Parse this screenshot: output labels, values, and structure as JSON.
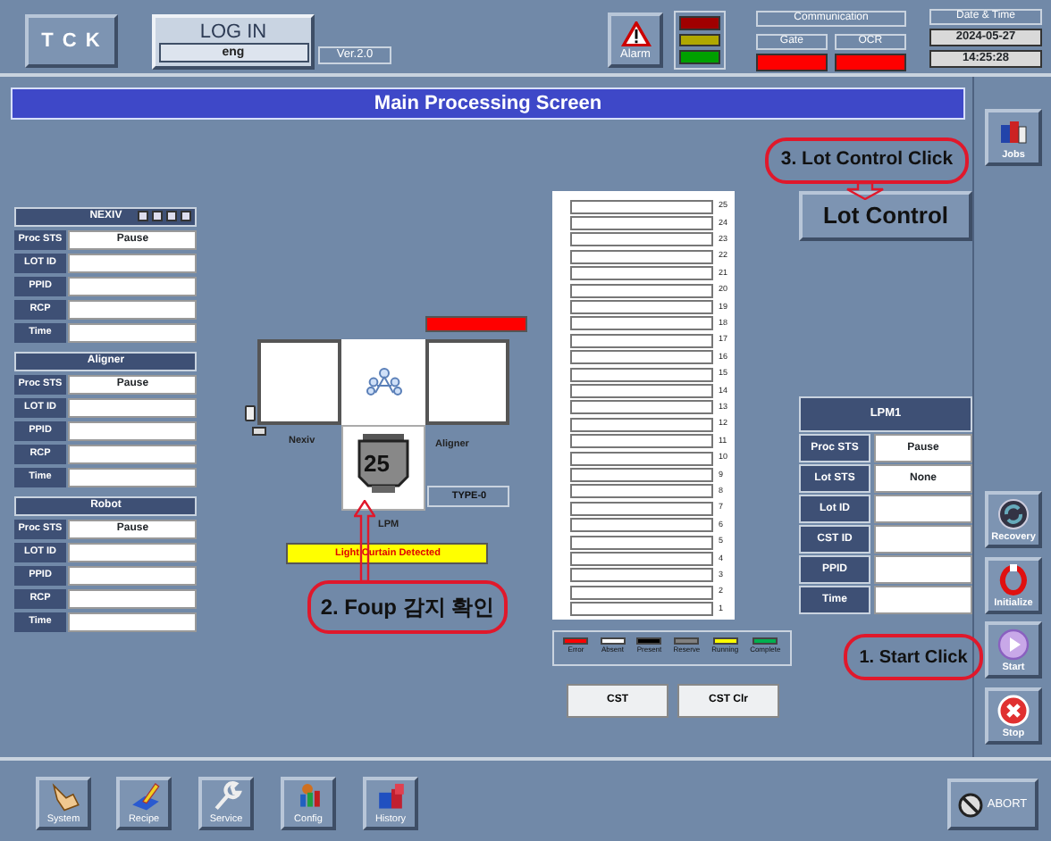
{
  "header": {
    "logo": "T C K",
    "login": {
      "label": "LOG IN",
      "user": "eng"
    },
    "version": "Ver.2.0",
    "alarm": "Alarm",
    "tower": [
      {
        "color": "#a00000"
      },
      {
        "color": "#b0a800"
      },
      {
        "color": "#00a000"
      }
    ],
    "communication": {
      "title": "Communication",
      "channels": [
        {
          "label": "Gate",
          "color": "#ff0000"
        },
        {
          "label": "OCR",
          "color": "#ff0000"
        }
      ]
    },
    "datetime": {
      "title": "Date & Time",
      "date": "2024-05-27",
      "time": "14:25:28"
    }
  },
  "title": "Main Processing Screen",
  "modules": [
    {
      "name": "NEXIV",
      "rows": [
        {
          "label": "Proc STS",
          "value": "Pause"
        },
        {
          "label": "LOT ID"
        },
        {
          "label": "PPID"
        },
        {
          "label": "RCP"
        },
        {
          "label": "Time"
        }
      ]
    },
    {
      "name": "Aligner",
      "rows": [
        {
          "label": "Proc STS",
          "value": "Pause"
        },
        {
          "label": "LOT ID"
        },
        {
          "label": "PPID"
        },
        {
          "label": "RCP"
        },
        {
          "label": "Time"
        }
      ]
    },
    {
      "name": "Robot",
      "rows": [
        {
          "label": "Proc STS",
          "value": "Pause"
        },
        {
          "label": "LOT ID"
        },
        {
          "label": "PPID"
        },
        {
          "label": "RCP"
        },
        {
          "label": "Time"
        }
      ]
    }
  ],
  "stage": {
    "indicator": {
      "color": "#ff0000"
    },
    "nexiv": "Nexiv",
    "aligner": "Aligner",
    "foup_count": "25",
    "type": "TYPE-0",
    "lpm": "LPM",
    "warning": "Light Curtain Detected"
  },
  "slots": [
    {
      "number": "25",
      "color": "#ffffff"
    },
    {
      "number": "24",
      "color": "#ffffff"
    },
    {
      "number": "23",
      "color": "#ffffff"
    },
    {
      "number": "22",
      "color": "#ffffff"
    },
    {
      "number": "21",
      "color": "#ffffff"
    },
    {
      "number": "20",
      "color": "#ffffff"
    },
    {
      "number": "19",
      "color": "#ffffff"
    },
    {
      "number": "18",
      "color": "#ffffff"
    },
    {
      "number": "17",
      "color": "#ffffff"
    },
    {
      "number": "16",
      "color": "#ffffff"
    },
    {
      "number": "15",
      "color": "#ffffff"
    },
    {
      "number": "14",
      "color": "#ffffff"
    },
    {
      "number": "13",
      "color": "#ffffff"
    },
    {
      "number": "12",
      "color": "#ffffff"
    },
    {
      "number": "11",
      "color": "#ffffff"
    },
    {
      "number": "10",
      "color": "#ffffff"
    },
    {
      "number": "9",
      "color": "#ffffff"
    },
    {
      "number": "8",
      "color": "#ffffff"
    },
    {
      "number": "7",
      "color": "#ffffff"
    },
    {
      "number": "6",
      "color": "#ffffff"
    },
    {
      "number": "5",
      "color": "#ffffff"
    },
    {
      "number": "4",
      "color": "#ffffff"
    },
    {
      "number": "3",
      "color": "#ffffff"
    },
    {
      "number": "2",
      "color": "#ffffff"
    },
    {
      "number": "1",
      "color": "#ffffff"
    }
  ],
  "legend": [
    {
      "label": "Error",
      "color": "#ff0000"
    },
    {
      "label": "Absent",
      "color": "#ffffff"
    },
    {
      "label": "Present",
      "color": "#000000"
    },
    {
      "label": "Reserve",
      "color": "#808080"
    },
    {
      "label": "Running",
      "color": "#ffff00"
    },
    {
      "label": "Complete",
      "color": "#00b050"
    }
  ],
  "cst_buttons": [
    "CST",
    "CST Clr"
  ],
  "lot_control": "Lot Control",
  "lpm_panel": {
    "title": "LPM1",
    "rows": [
      {
        "label": "Proc STS",
        "value": "Pause"
      },
      {
        "label": "Lot STS",
        "value": "None"
      },
      {
        "label": "Lot ID"
      },
      {
        "label": "CST ID"
      },
      {
        "label": "PPID"
      },
      {
        "label": "Time"
      }
    ]
  },
  "side_buttons": [
    {
      "kind": "jobs",
      "label": "Jobs"
    },
    {
      "kind": "recovery",
      "label": "Recovery"
    },
    {
      "kind": "initialize",
      "label": "Initialize"
    },
    {
      "kind": "start",
      "label": "Start"
    },
    {
      "kind": "stop",
      "label": "Stop"
    }
  ],
  "menu": [
    {
      "kind": "system",
      "label": "System"
    },
    {
      "kind": "recipe",
      "label": "Recipe"
    },
    {
      "kind": "service",
      "label": "Service"
    },
    {
      "kind": "config",
      "label": "Config"
    },
    {
      "kind": "history",
      "label": "History"
    }
  ],
  "abort": "ABORT",
  "annotations": [
    {
      "kind": "lot",
      "text": "3. Lot Control Click"
    },
    {
      "kind": "foup",
      "text": "2. Foup 감지 확인"
    },
    {
      "kind": "start",
      "text": "1. Start Click"
    }
  ]
}
